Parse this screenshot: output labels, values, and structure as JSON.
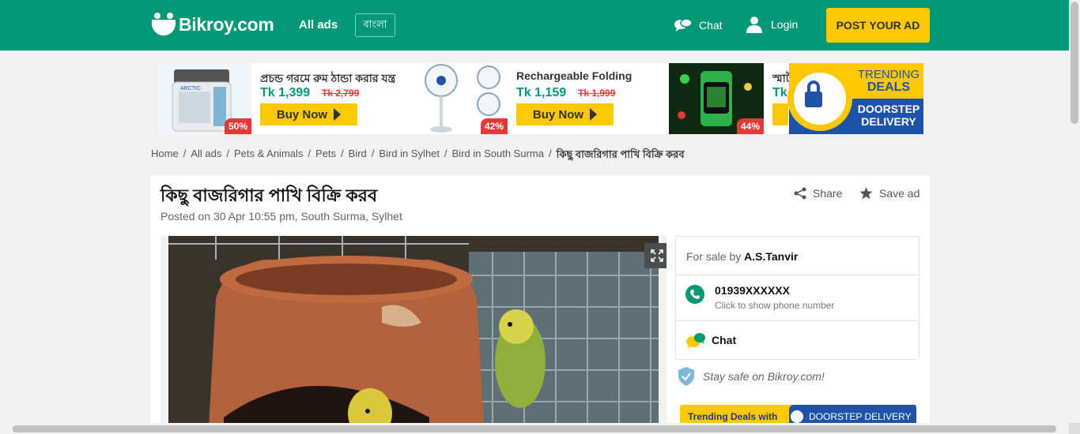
{
  "header": {
    "logo_text": "Bikroy.com",
    "all_ads": "All ads",
    "language": "বাংলা",
    "chat": "Chat",
    "login": "Login",
    "post_ad": "POST YOUR AD"
  },
  "banner": {
    "products": [
      {
        "name": "প্রচন্ড গরমে রুম ঠান্ডা করার যন্ত্র",
        "price": "Tk 1,399",
        "old_price": "Tk 2,799",
        "discount": "50%",
        "buy": "Buy Now"
      },
      {
        "name": "Rechargeable Folding",
        "price": "Tk 1,159",
        "old_price": "Tk 1,999",
        "discount": "42%",
        "buy": "Buy Now"
      },
      {
        "name": "স্মার্ট",
        "price": "Tk",
        "discount": "44%"
      }
    ],
    "trending_line1": "TRENDING",
    "trending_line2": "DEALS",
    "delivery_line1": "DOORSTEP",
    "delivery_line2": "DELIVERY"
  },
  "breadcrumb": [
    "Home",
    "All ads",
    "Pets & Animals",
    "Pets",
    "Bird",
    "Bird in Sylhet",
    "Bird in South Surma",
    "কিছু বাজরিগার পাখি বিক্রি করব"
  ],
  "ad": {
    "title": "কিছু বাজরিগার পাখি বিক্রি করব",
    "posted": "Posted on 30 Apr 10:55 pm, South Surma, Sylhet",
    "share": "Share",
    "save": "Save ad"
  },
  "seller": {
    "for_sale_by": "For sale by",
    "name": "A.S.Tanvir",
    "phone": "01939XXXXXX",
    "phone_hint": "Click to show phone number",
    "chat": "Chat"
  },
  "stay_safe": "Stay safe on Bikroy.com!",
  "trend_banner": {
    "left": "Trending Deals with",
    "right": "DOORSTEP DELIVERY"
  },
  "colors": {
    "brand": "#009877",
    "accent": "#ffc800",
    "delivery_blue": "#1e53a7"
  }
}
